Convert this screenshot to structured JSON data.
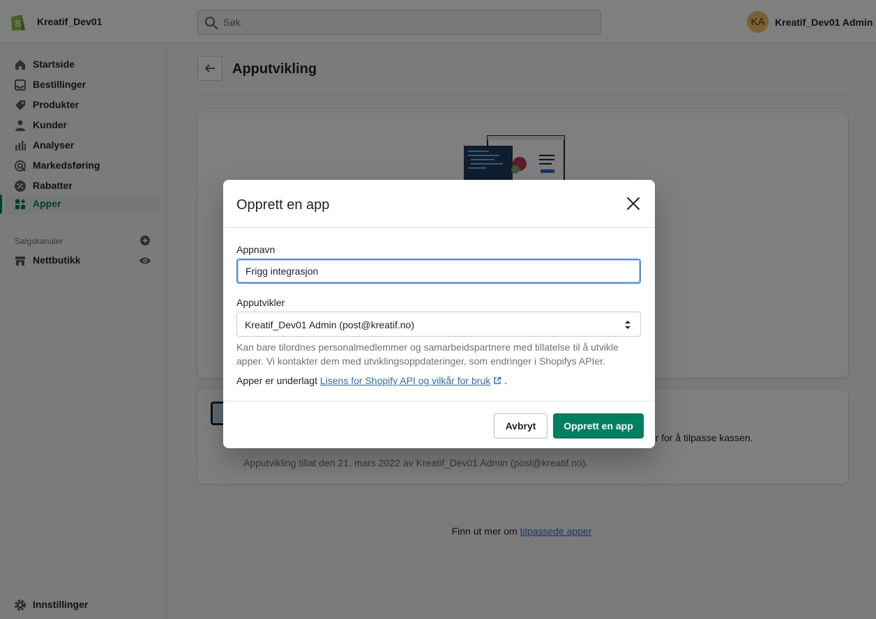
{
  "topbar": {
    "store_name": "Kreatif_Dev01",
    "search_placeholder": "Søk",
    "user_initials": "KA",
    "user_name": "Kreatif_Dev01 Admin"
  },
  "sidebar": {
    "items": [
      {
        "label": "Startside",
        "icon": "home-icon"
      },
      {
        "label": "Bestillinger",
        "icon": "inbox-icon"
      },
      {
        "label": "Produkter",
        "icon": "tag-icon"
      },
      {
        "label": "Kunder",
        "icon": "person-icon"
      },
      {
        "label": "Analyser",
        "icon": "bar-chart-icon"
      },
      {
        "label": "Markedsføring",
        "icon": "target-icon"
      },
      {
        "label": "Rabatter",
        "icon": "discount-icon"
      },
      {
        "label": "Apper",
        "icon": "apps-icon",
        "active": true
      }
    ],
    "channels_heading": "Salgskanaler",
    "channel_item": "Nettbutikk",
    "settings_label": "Innstillinger"
  },
  "main": {
    "page_title": "Apputvikling",
    "card2_text": "per for å tilpasse kassen.",
    "card2_date": "Apputvikling tillat den 21. mars 2022 av Kreatif_Dev01 Admin (post@kreatif.no).",
    "learn_more_prefix": "Finn ut mer om ",
    "learn_more_link": "tilpassede apper"
  },
  "modal": {
    "title": "Opprett en app",
    "app_name_label": "Appnavn",
    "app_name_value": "Frigg integrasjon",
    "developer_label": "Apputvikler",
    "developer_value": "Kreatif_Dev01 Admin (post@kreatif.no)",
    "help_text": "Kan bare tilordnes personalmedlemmer og samarbeidspartnere med tillatelse til å utvikle apper. Vi kontakter dem med utviklingsoppdateringer, som endringer i Shopifys APIer.",
    "terms_prefix": "Apper er underlagt ",
    "terms_link": "Lisens for Shopify API og vilkår for bruk",
    "terms_suffix": ".",
    "cancel_label": "Avbryt",
    "create_label": "Opprett en app"
  },
  "colors": {
    "primary": "#008060",
    "link": "#2c6ecb",
    "focus": "#458fff"
  }
}
